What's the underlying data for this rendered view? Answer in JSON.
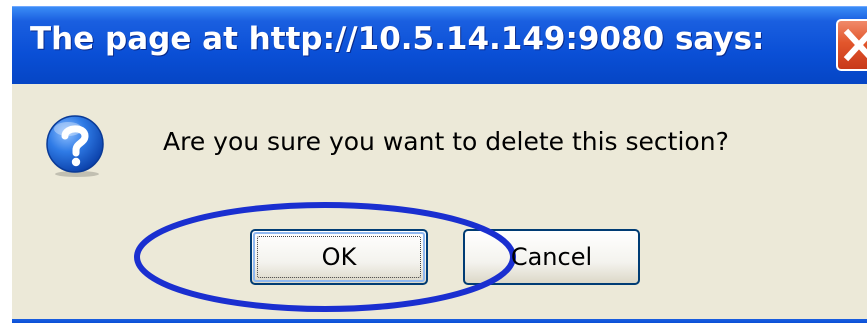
{
  "dialog": {
    "title": "The page at http://10.5.14.149:9080 says:",
    "message": "Are you sure you want to delete this section?",
    "buttons": {
      "ok_label": "OK",
      "cancel_label": "Cancel"
    },
    "icons": {
      "message_icon": "question-icon",
      "close_icon": "close-icon"
    },
    "colors": {
      "titlebar": "#0a4fd6",
      "body": "#ece9d8",
      "close_button": "#e2562c",
      "annotation_ellipse": "#1a2fd0"
    }
  },
  "annotation": {
    "shape": "ellipse",
    "target": "ok-button"
  }
}
